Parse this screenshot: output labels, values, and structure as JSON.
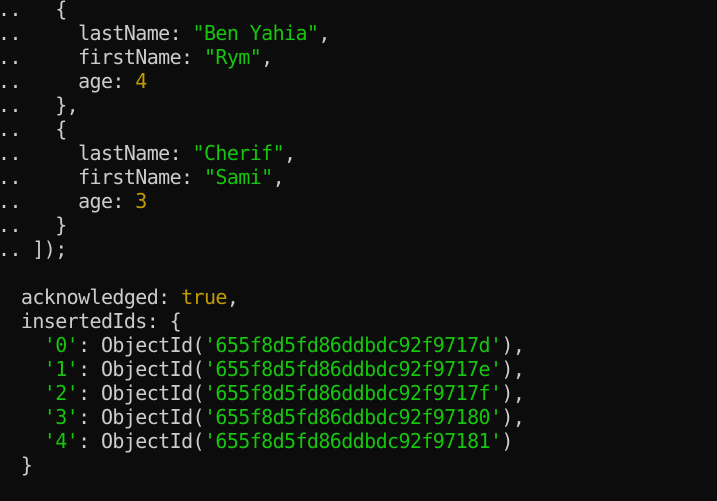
{
  "colors": {
    "background": "#0c0c0c",
    "text": "#cccccc",
    "string": "#16c60c",
    "number": "#c19c00",
    "boolean": "#c19c00"
  },
  "terminal": {
    "lines": [
      [
        {
          "t": "..   {",
          "c": "plain"
        }
      ],
      [
        {
          "t": "..     lastName: ",
          "c": "plain"
        },
        {
          "t": "\"Ben Yahia\"",
          "c": "str"
        },
        {
          "t": ",",
          "c": "plain"
        }
      ],
      [
        {
          "t": "..     firstName: ",
          "c": "plain"
        },
        {
          "t": "\"Rym\"",
          "c": "str"
        },
        {
          "t": ",",
          "c": "plain"
        }
      ],
      [
        {
          "t": "..     age: ",
          "c": "plain"
        },
        {
          "t": "4",
          "c": "num"
        }
      ],
      [
        {
          "t": "..   },",
          "c": "plain"
        }
      ],
      [
        {
          "t": "..   {",
          "c": "plain"
        }
      ],
      [
        {
          "t": "..     lastName: ",
          "c": "plain"
        },
        {
          "t": "\"Cherif\"",
          "c": "str"
        },
        {
          "t": ",",
          "c": "plain"
        }
      ],
      [
        {
          "t": "..     firstName: ",
          "c": "plain"
        },
        {
          "t": "\"Sami\"",
          "c": "str"
        },
        {
          "t": ",",
          "c": "plain"
        }
      ],
      [
        {
          "t": "..     age: ",
          "c": "plain"
        },
        {
          "t": "3",
          "c": "num"
        }
      ],
      [
        {
          "t": "..   }",
          "c": "plain"
        }
      ],
      [
        {
          "t": ".. ]);",
          "c": "plain"
        }
      ],
      [],
      [
        {
          "t": "  acknowledged: ",
          "c": "plain"
        },
        {
          "t": "true",
          "c": "kw"
        },
        {
          "t": ",",
          "c": "plain"
        }
      ],
      [
        {
          "t": "  insertedIds: {",
          "c": "plain"
        }
      ],
      [
        {
          "t": "    ",
          "c": "plain"
        },
        {
          "t": "'0'",
          "c": "str"
        },
        {
          "t": ": ObjectId(",
          "c": "plain"
        },
        {
          "t": "'655f8d5fd86ddbdc92f9717d'",
          "c": "str"
        },
        {
          "t": "),",
          "c": "plain"
        }
      ],
      [
        {
          "t": "    ",
          "c": "plain"
        },
        {
          "t": "'1'",
          "c": "str"
        },
        {
          "t": ": ObjectId(",
          "c": "plain"
        },
        {
          "t": "'655f8d5fd86ddbdc92f9717e'",
          "c": "str"
        },
        {
          "t": "),",
          "c": "plain"
        }
      ],
      [
        {
          "t": "    ",
          "c": "plain"
        },
        {
          "t": "'2'",
          "c": "str"
        },
        {
          "t": ": ObjectId(",
          "c": "plain"
        },
        {
          "t": "'655f8d5fd86ddbdc92f9717f'",
          "c": "str"
        },
        {
          "t": "),",
          "c": "plain"
        }
      ],
      [
        {
          "t": "    ",
          "c": "plain"
        },
        {
          "t": "'3'",
          "c": "str"
        },
        {
          "t": ": ObjectId(",
          "c": "plain"
        },
        {
          "t": "'655f8d5fd86ddbdc92f97180'",
          "c": "str"
        },
        {
          "t": "),",
          "c": "plain"
        }
      ],
      [
        {
          "t": "    ",
          "c": "plain"
        },
        {
          "t": "'4'",
          "c": "str"
        },
        {
          "t": ": ObjectId(",
          "c": "plain"
        },
        {
          "t": "'655f8d5fd86ddbdc92f97181'",
          "c": "str"
        },
        {
          "t": ")",
          "c": "plain"
        }
      ],
      [
        {
          "t": "  }",
          "c": "plain"
        }
      ]
    ]
  }
}
